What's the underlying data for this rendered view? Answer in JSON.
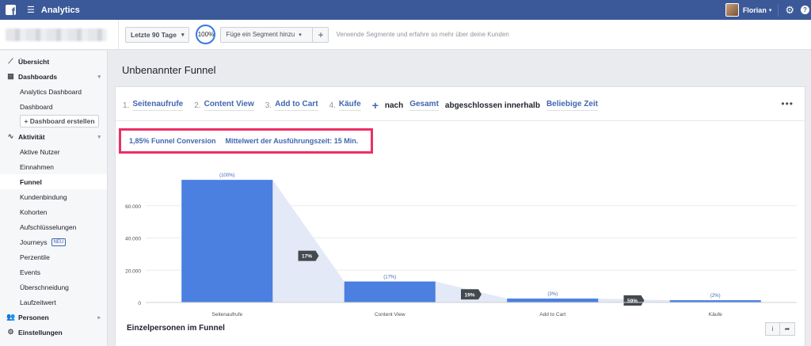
{
  "topbar": {
    "logo_letter": "f",
    "menu_icon": "hamburger-icon",
    "title": "Analytics",
    "user_name": "Florian",
    "caret": "▾",
    "settings_icon": "gear-icon",
    "help_icon": "help-icon",
    "help_glyph": "?"
  },
  "segbar": {
    "date_range": "Letzte 90 Tage",
    "date_caret": "▾",
    "percent": "100%",
    "segment_placeholder": "Füge ein Segment hinzu",
    "segment_caret": "▾",
    "add_glyph": "+",
    "hint": "Verwende Segmente und erfahre so mehr über deine Kunden"
  },
  "sidebar": {
    "overview": "Übersicht",
    "dashboards": "Dashboards",
    "dashboard_items": [
      "Analytics Dashboard",
      "Dashboard"
    ],
    "create_dashboard": "+ Dashboard erstellen",
    "activity": "Aktivität",
    "activity_items": [
      "Aktive Nutzer",
      "Einnahmen",
      "Funnel",
      "Kundenbindung",
      "Kohorten",
      "Aufschlüsselungen",
      "Journeys",
      "Perzentile",
      "Events",
      "Überschneidung",
      "Laufzeitwert"
    ],
    "journeys_badge": "NEU",
    "people": "Personen",
    "settings": "Einstellungen",
    "chevron_down": "▾",
    "chevron_right": "▸"
  },
  "main": {
    "page_title": "Unbenannter Funnel",
    "steps": [
      {
        "num": "1.",
        "label": "Seitenaufrufe"
      },
      {
        "num": "2.",
        "label": "Content View"
      },
      {
        "num": "3.",
        "label": "Add to Cart"
      },
      {
        "num": "4.",
        "label": "Käufe"
      }
    ],
    "add_step": "+",
    "after": "nach",
    "scope": "Gesamt",
    "completed_within": "abgeschlossen innerhalb",
    "timeframe": "Beliebige Zeit",
    "more": "•••",
    "summary_conversion": "1,85% Funnel Conversion",
    "summary_time": "Mittelwert der Ausführungszeit: 15 Min.",
    "people_title": "Einzelpersonen im Funnel",
    "info_glyph": "i",
    "share_glyph": "➦"
  },
  "chart_data": {
    "type": "bar",
    "categories": [
      "Seitenaufrufe",
      "Content View",
      "Add to Cart",
      "Käufe"
    ],
    "values": [
      76000,
      13000,
      2400,
      1400
    ],
    "bar_labels": [
      "(100%)",
      "(17%)",
      "(3%)",
      "(2%)"
    ],
    "step_conversions": [
      "17%",
      "19%",
      "59%"
    ],
    "y_ticks": [
      0,
      20000,
      40000,
      60000
    ],
    "y_tick_labels": [
      "0",
      "20.000",
      "40.000",
      "60.000"
    ],
    "ylim": [
      0,
      80000
    ],
    "bar_color": "#4b7fe0",
    "flow_color": "#e4e9f7",
    "grid": true
  }
}
